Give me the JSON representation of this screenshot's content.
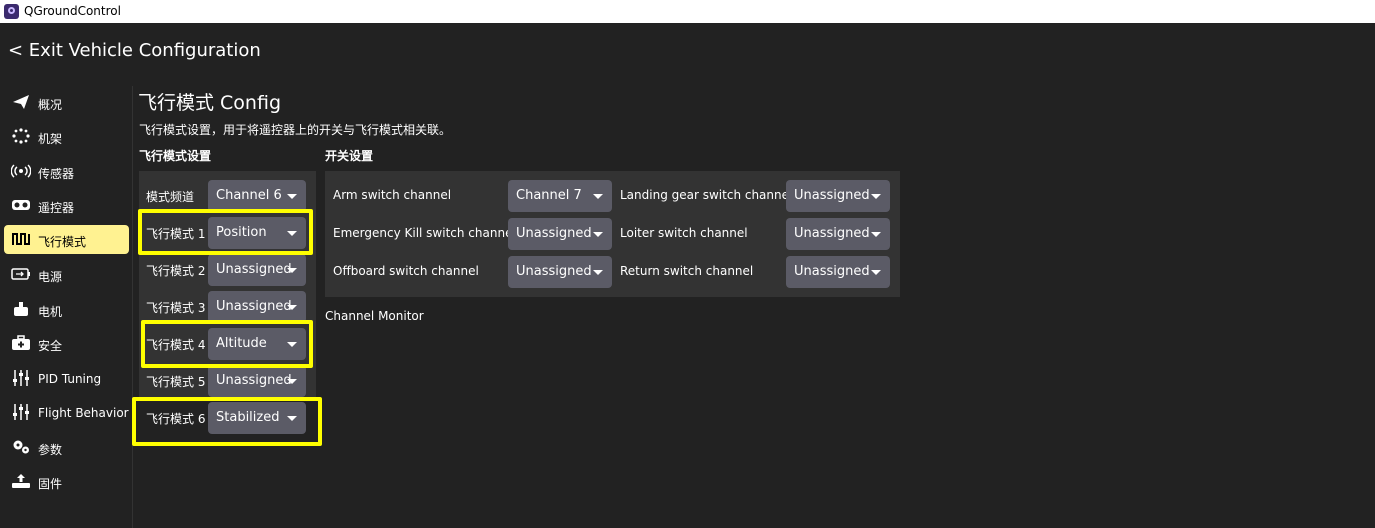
{
  "window": {
    "title": "QGroundControl"
  },
  "header": {
    "exit_label": "<  Exit Vehicle Configuration"
  },
  "sidebar": {
    "items": [
      {
        "label": "概况",
        "icon": "paper-plane-icon"
      },
      {
        "label": "机架",
        "icon": "frame-dots-icon"
      },
      {
        "label": "传感器",
        "icon": "sensor-waves-icon"
      },
      {
        "label": "遥控器",
        "icon": "remote-control-icon"
      },
      {
        "label": "飞行模式",
        "icon": "flight-mode-wave-icon",
        "active": true
      },
      {
        "label": "电源",
        "icon": "battery-icon"
      },
      {
        "label": "电机",
        "icon": "motor-icon"
      },
      {
        "label": "安全",
        "icon": "first-aid-kit-icon"
      },
      {
        "label": "PID Tuning",
        "icon": "sliders-icon"
      },
      {
        "label": "Flight Behavior",
        "icon": "sliders-icon"
      },
      {
        "label": "参数",
        "icon": "gears-icon"
      },
      {
        "label": "固件",
        "icon": "firmware-upload-icon"
      }
    ]
  },
  "main": {
    "title": "飞行模式 Config",
    "description": "飞行模式设置，用于将遥控器上的开关与飞行模式相关联。",
    "flight_modes_section": {
      "title": "飞行模式设置",
      "channel_label": "模式频道",
      "channel_value": "Channel 6",
      "modes": [
        {
          "label": "飞行模式 1",
          "value": "Position"
        },
        {
          "label": "飞行模式 2",
          "value": "Unassigned"
        },
        {
          "label": "飞行模式 3",
          "value": "Unassigned"
        },
        {
          "label": "飞行模式 4",
          "value": "Altitude"
        },
        {
          "label": "飞行模式 5",
          "value": "Unassigned"
        },
        {
          "label": "飞行模式 6",
          "value": "Stabilized"
        }
      ]
    },
    "switch_section": {
      "title": "开关设置",
      "switches": [
        {
          "label": "Arm switch channel",
          "value": "Channel 7"
        },
        {
          "label": "Landing gear switch channel",
          "value": "Unassigned"
        },
        {
          "label": "Emergency Kill switch channel",
          "value": "Unassigned"
        },
        {
          "label": "Loiter switch channel",
          "value": "Unassigned"
        },
        {
          "label": "Offboard switch channel",
          "value": "Unassigned"
        },
        {
          "label": "Return switch channel",
          "value": "Unassigned"
        }
      ]
    },
    "channel_monitor_label": "Channel Monitor"
  },
  "colors": {
    "background": "#222222",
    "panel": "#333333",
    "combo": "#5b5b66",
    "active_item": "#fff291",
    "highlight": "#ffff00"
  }
}
